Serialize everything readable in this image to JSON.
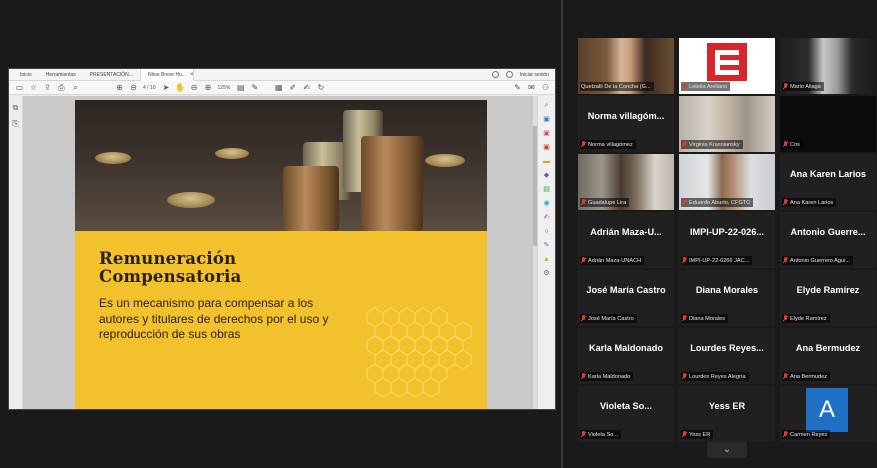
{
  "viewer": {
    "menu_tabs": [
      "Inicio",
      "Herramientas",
      "PRESENTACIÓN...",
      "Nitoe Breve Hu..."
    ],
    "close_glyph": "×",
    "sign_in": "Iniciar sesión",
    "toolbar": {
      "page_box": "4 / 10",
      "zoom": "125%"
    }
  },
  "slide": {
    "title_line1": "Remuneración",
    "title_line2": "Compensatoria",
    "body": "Es un mecanismo para compensar a los autores y titulares de derechos por el uso y reproducción de sus obras"
  },
  "participants": [
    {
      "label": "Quetzalli De la Concha (G...",
      "kind": "video",
      "active": true
    },
    {
      "label": "Letelia Arellano",
      "kind": "logo"
    },
    {
      "label": "Mario Aliaga",
      "kind": "video"
    },
    {
      "name": "Norma villagóm...",
      "label": "Norma villagómez",
      "kind": "name"
    },
    {
      "label": "Virginia Krasniansky",
      "kind": "video"
    },
    {
      "label": "Cris",
      "kind": "blank"
    },
    {
      "label": "Guadalupe Lira",
      "kind": "video"
    },
    {
      "label": "Eduardo Aburto, CFGTO",
      "kind": "video"
    },
    {
      "name": "Ana Karen Larios",
      "label": "Ana Karen Larios",
      "kind": "name"
    },
    {
      "name": "Adrián Maza-U...",
      "label": "Adrián Maza-UNACH",
      "kind": "name"
    },
    {
      "name": "IMPI-UP-22-026...",
      "label": "IMPI-UP-22-0266 JAC...",
      "kind": "name"
    },
    {
      "name": "Antonio Guerre...",
      "label": "Antonio Guerrero Agui...",
      "kind": "name"
    },
    {
      "name": "José María Castro",
      "label": "José María Castro",
      "kind": "name"
    },
    {
      "name": "Diana Morales",
      "label": "Diana Morales",
      "kind": "name"
    },
    {
      "name": "Elyde Ramírez",
      "label": "Elyde Ramírez",
      "kind": "name"
    },
    {
      "name": "Karla Maldonado",
      "label": "Karla Maldonado",
      "kind": "name"
    },
    {
      "name": "Lourdes Reyes...",
      "label": "Lourdes Reyes Alegría",
      "kind": "name"
    },
    {
      "name": "Ana Bermudez",
      "label": "Ana Bermudez",
      "kind": "name"
    },
    {
      "name": "Violeta So...",
      "label": "Violeta So...",
      "kind": "name"
    },
    {
      "name": "Yess ER",
      "label": "Yess ER",
      "kind": "name"
    },
    {
      "avatar": "A",
      "label": "Carmen Reyes",
      "kind": "avatar"
    }
  ],
  "gallery": {
    "scroll_glyph": "⌄"
  },
  "colors": {
    "slide_yellow": "#f2c12b",
    "active_speaker": "#c9d93a",
    "muted_red": "#e03a2f",
    "avatar_blue": "#1f6fc4",
    "logo_red": "#d7262b"
  }
}
